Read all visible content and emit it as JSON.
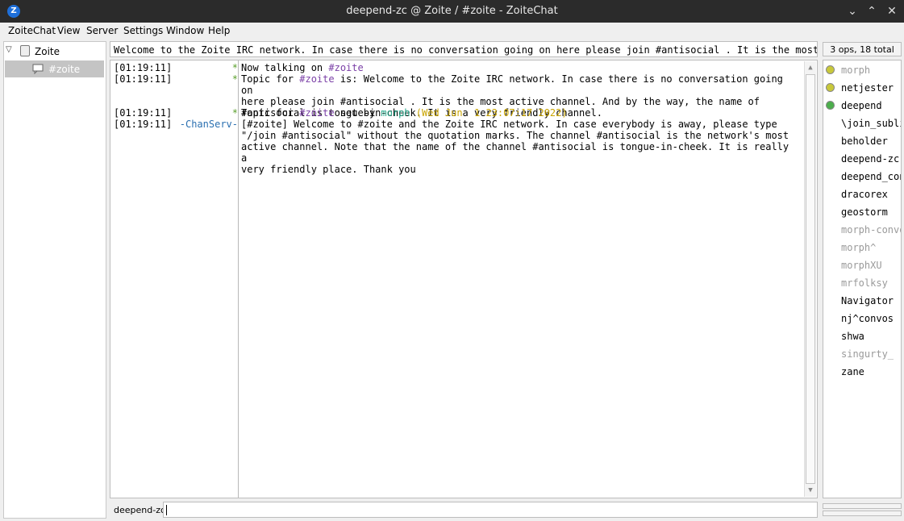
{
  "window": {
    "title": "deepend-zc @ Zoite / #zoite - ZoiteChat",
    "logo_letter": "Z",
    "minimize_glyph": "⌄",
    "maximize_glyph": "⌃",
    "close_glyph": "✕"
  },
  "menu": {
    "items": [
      {
        "label": "ZoiteChat"
      },
      {
        "label": "View"
      },
      {
        "label": "Server"
      },
      {
        "label": "Settings"
      },
      {
        "label": "Window"
      },
      {
        "label": "Help"
      }
    ]
  },
  "tree": {
    "network": "Zoite",
    "channel": "#zoite"
  },
  "topic_bar": {
    "text": "Welcome to the Zoite IRC network. In case there is no conversation going on here please join #antisocial . It is the most active channel. And by the way, the name of #antisocial is tongue-in-cheek. It is a very friendly channel."
  },
  "user_count": "3 ops, 18 total",
  "messages": [
    {
      "time": "[01:19:11]",
      "nick": "*",
      "text": "Now talking on #zoite"
    },
    {
      "time": "[01:19:11]",
      "nick": "*",
      "text": "Topic for #zoite is: Welcome to the Zoite IRC network. In case there is no conversation going on here please join #antisocial . It is the most active channel. And by the way, the name of #antisocial is tongue-in-cheek. It is a very friendly channel."
    },
    {
      "time": "[01:19:11]",
      "nick": "*",
      "text": "Topic for #zoite set by morph (Wed Jun  1 23:07:17 2022)"
    },
    {
      "time": "[01:19:11]",
      "nick": "-ChanServ-",
      "text": "[#zoite] Welcome to #zoite and the Zoite IRC network. In case everybody is away, please type \"/join #antisocial\" without the quotation marks. The channel #antisocial is the network's most active channel. Note that the name of the channel #antisocial is tongue-in-cheek. It is really a very friendly place. Thank you"
    }
  ],
  "users": [
    {
      "name": "morph",
      "status": "op",
      "away": true
    },
    {
      "name": "netjester",
      "status": "op",
      "away": false
    },
    {
      "name": "deepend",
      "status": "voice",
      "away": false
    },
    {
      "name": "\\join_subli",
      "status": "",
      "away": false
    },
    {
      "name": "beholder",
      "status": "",
      "away": false
    },
    {
      "name": "deepend-zc",
      "status": "",
      "away": false
    },
    {
      "name": "deepend_con",
      "status": "",
      "away": false
    },
    {
      "name": "dracorex",
      "status": "",
      "away": false
    },
    {
      "name": "geostorm",
      "status": "",
      "away": false
    },
    {
      "name": "morph-convo",
      "status": "",
      "away": true
    },
    {
      "name": "morph^",
      "status": "",
      "away": true
    },
    {
      "name": "morphXU",
      "status": "",
      "away": true
    },
    {
      "name": "mrfolksy",
      "status": "",
      "away": true
    },
    {
      "name": "Navigator",
      "status": "",
      "away": false
    },
    {
      "name": "nj^convos",
      "status": "",
      "away": false
    },
    {
      "name": "shwa",
      "status": "",
      "away": false
    },
    {
      "name": "singurty_",
      "status": "",
      "away": true
    },
    {
      "name": "zane",
      "status": "",
      "away": false
    }
  ],
  "input": {
    "nick": "deepend-zc",
    "value": ""
  },
  "colors": {
    "channel": "#7a3fa6",
    "nick_green": "#27a78a",
    "date": "#c9a400",
    "chanserv": "#2a6fb0",
    "star_green": "#5aa02c",
    "op_dot": "#c8c83a",
    "voice_dot": "#4cae4c",
    "away": "#9a9a9a"
  }
}
